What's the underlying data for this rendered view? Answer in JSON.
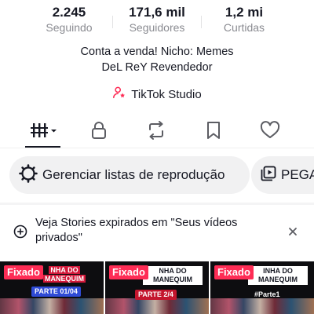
{
  "stats": [
    {
      "value": "2.245",
      "label": "Seguindo"
    },
    {
      "value": "171,6 mil",
      "label": "Seguidores"
    },
    {
      "value": "1,2 mi",
      "label": "Curtidas"
    }
  ],
  "bio": {
    "line1": "Conta a venda! Nicho: Memes",
    "line2": "DeL ReY Revendedor"
  },
  "studio": {
    "label": "TikTok Studio",
    "accent": "#fe2c55"
  },
  "tabs": [
    {
      "icon": "grid-icon",
      "active": true
    },
    {
      "icon": "lock-icon",
      "active": false
    },
    {
      "icon": "repost-icon",
      "active": false
    },
    {
      "icon": "bookmark-icon",
      "active": false
    },
    {
      "icon": "heart-icon",
      "active": false
    }
  ],
  "chips": [
    {
      "icon": "playlist-settings-icon",
      "label": "Gerenciar listas de reprodução"
    },
    {
      "icon": "playlist-icon",
      "label": "PEGA"
    }
  ],
  "notice": {
    "text": "Veja Stories expirados em \"Seus vídeos privados\"",
    "icon": "add-story-icon",
    "close_icon": "close-icon"
  },
  "videos": [
    {
      "pinned_label": "Fixado",
      "banner_l1": "NHA DO",
      "banner_l2": "MANEQUIM",
      "part": "PARTE 01/04"
    },
    {
      "pinned_label": "Fixado",
      "banner_l1": "NHA DO",
      "banner_l2": "MANEQUIM",
      "part": "PARTE 2/4"
    },
    {
      "pinned_label": "Fixado",
      "banner_l1": "INHA DO",
      "banner_l2": "MANEQUIM",
      "part": "#Parte1"
    }
  ]
}
